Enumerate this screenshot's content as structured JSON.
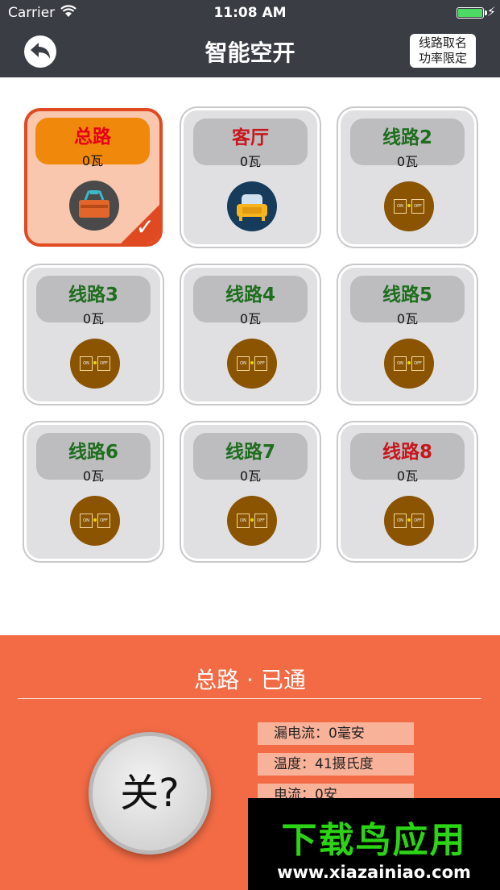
{
  "status_bar": {
    "carrier": "Carrier",
    "time": "11:08 AM"
  },
  "header": {
    "title": "智能空开",
    "right_button_line1": "线路取名",
    "right_button_line2": "功率限定"
  },
  "tiles": [
    {
      "name": "总路",
      "power": "0瓦",
      "name_color": "#e60012",
      "icon": "toolbox-icon",
      "selected": true
    },
    {
      "name": "客厅",
      "power": "0瓦",
      "name_color": "#c8161d",
      "icon": "sofa-icon",
      "selected": false
    },
    {
      "name": "线路2",
      "power": "0瓦",
      "name_color": "#1e6e1e",
      "icon": "switch-icon",
      "selected": false
    },
    {
      "name": "线路3",
      "power": "0瓦",
      "name_color": "#1e6e1e",
      "icon": "switch-icon",
      "selected": false
    },
    {
      "name": "线路4",
      "power": "0瓦",
      "name_color": "#1e6e1e",
      "icon": "switch-icon",
      "selected": false
    },
    {
      "name": "线路5",
      "power": "0瓦",
      "name_color": "#1e6e1e",
      "icon": "switch-icon",
      "selected": false
    },
    {
      "name": "线路6",
      "power": "0瓦",
      "name_color": "#1e6e1e",
      "icon": "switch-icon",
      "selected": false
    },
    {
      "name": "线路7",
      "power": "0瓦",
      "name_color": "#1e6e1e",
      "icon": "switch-icon",
      "selected": false
    },
    {
      "name": "线路8",
      "power": "0瓦",
      "name_color": "#c8161d",
      "icon": "switch-icon",
      "selected": false
    }
  ],
  "switch_labels": {
    "on": "ON",
    "off": "OFF"
  },
  "panel": {
    "title": "总路 · 已通",
    "toggle_label": "关?",
    "info": [
      "漏电流：0毫安",
      "温度：41摄氏度",
      "电流：0安"
    ]
  },
  "watermark": {
    "main": "下载鸟应用",
    "sub": "www.xiazainiao.com"
  },
  "colors": {
    "header_bg": "#3a3d44",
    "panel_bg": "#f26b45",
    "accent": "#e04a22",
    "active_label": "#f0880c"
  }
}
